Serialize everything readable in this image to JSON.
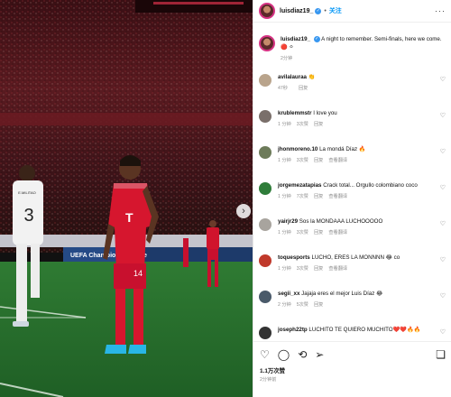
{
  "post": {
    "username": "luisdiaz19_",
    "verified_mark": "✓",
    "dot": "•",
    "follow_label": "关注",
    "more_label": "···",
    "caption_username": "luisdiaz19_",
    "caption_text": "A night to remember. Semi-finals, here we come. 🔴 ⚪",
    "caption_time": "2分钟",
    "likes": "1.1万次赞",
    "time": "2分钟前",
    "ad_board_text": "UEFA Champions League",
    "jersey_number": "14",
    "opponent_jersey_number": "3",
    "opponent_jersey_name": "E.MILITAO"
  },
  "comments": [
    {
      "username": "avilalauraa",
      "text": "👏",
      "time": "47秒",
      "likes": "",
      "reply": "回复",
      "avatar_color": "#b9a48c"
    },
    {
      "username": "krublemmstr",
      "text": "I love you",
      "time": "1 分钟",
      "likes": "3次赞",
      "reply": "回复",
      "avatar_color": "#7a6f6a"
    },
    {
      "username": "jhonmoreno.10",
      "text": "La mondá Díaz 🔥",
      "time": "1 分钟",
      "likes": "3次赞",
      "reply": "回复",
      "extra": "查看翻译",
      "avatar_color": "#6d7b5a"
    },
    {
      "username": "jorgemezatapias",
      "text": "Crack total... Orgullo colombiano coco",
      "time": "1 分钟",
      "likes": "7次赞",
      "reply": "回复",
      "extra": "查看翻译",
      "avatar_color": "#2f7d3a"
    },
    {
      "username": "yairjr29",
      "text": "Sos la MONDAAA LUCHOOOOO",
      "time": "1 分钟",
      "likes": "3次赞",
      "reply": "回复",
      "extra": "查看翻译",
      "avatar_color": "#a8a49e"
    },
    {
      "username": "toquesports",
      "text": "LUCHO, ERES LA MONNNN 😂 co",
      "time": "1 分钟",
      "likes": "3次赞",
      "reply": "回复",
      "extra": "查看翻译",
      "avatar_color": "#c0392b"
    },
    {
      "username": "segii_xx",
      "text": "Jajaja eres el mejor Luis Díaz 😂",
      "time": "2 分钟",
      "likes": "5次赞",
      "reply": "回复",
      "avatar_color": "#4a5a6a"
    },
    {
      "username": "joseph22tp",
      "text": "LUCHITO TE QUIERO MUCHITO❤️❤️🔥🔥",
      "time": "",
      "likes": "",
      "reply": "",
      "avatar_color": "#333"
    }
  ]
}
